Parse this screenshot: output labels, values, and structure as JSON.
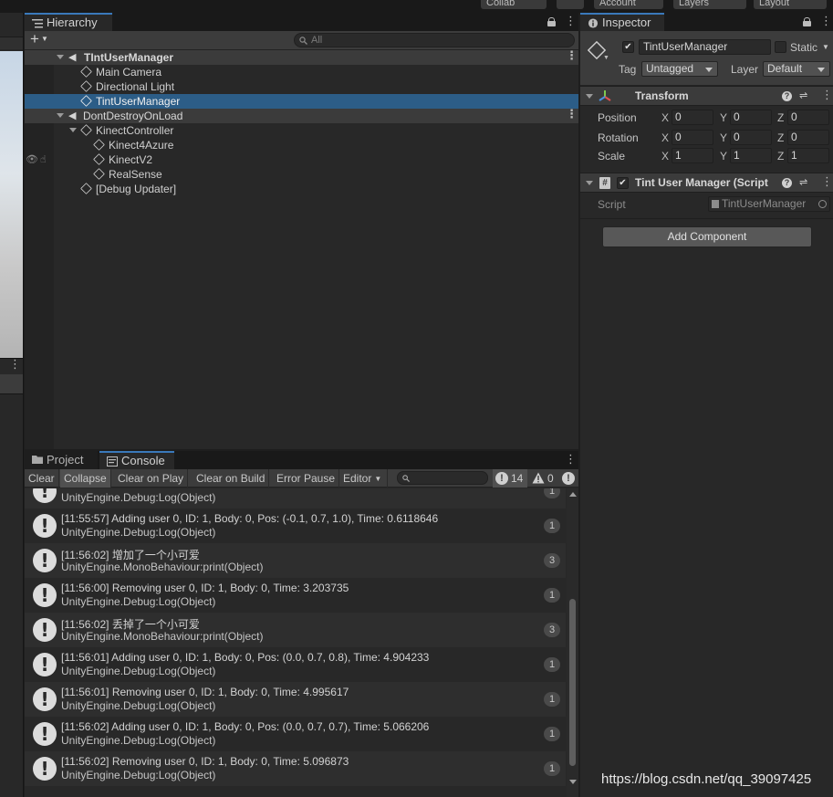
{
  "topbar": {
    "collab": "Collab",
    "account": "Account",
    "layers": "Layers",
    "layout": "Layout"
  },
  "hierarchy": {
    "tab_label": "Hierarchy",
    "search_placeholder": "All",
    "items": [
      {
        "label": "TIntUserManager",
        "kind": "scene"
      },
      {
        "label": "Main Camera",
        "kind": "object"
      },
      {
        "label": "Directional Light",
        "kind": "object"
      },
      {
        "label": "TintUserManager",
        "kind": "object",
        "selected": true
      },
      {
        "label": "DontDestroyOnLoad",
        "kind": "scene"
      },
      {
        "label": "KinectController",
        "kind": "object"
      },
      {
        "label": "Kinect4Azure",
        "kind": "object"
      },
      {
        "label": "KinectV2",
        "kind": "object"
      },
      {
        "label": "RealSense",
        "kind": "object"
      },
      {
        "label": "[Debug Updater]",
        "kind": "object"
      }
    ]
  },
  "console": {
    "tabs": [
      "Project",
      "Console"
    ],
    "toolbar": [
      "Clear",
      "Collapse",
      "Clear on Play",
      "Clear on Build",
      "Error Pause",
      "Editor"
    ],
    "counts": {
      "info": "14",
      "warnings": "0"
    },
    "entries": [
      {
        "line1": "",
        "line2": "UnityEngine.Debug:Log(Object)",
        "count": "1"
      },
      {
        "line1": "[11:55:57] Adding user 0, ID: 1, Body: 0, Pos: (-0.1, 0.7, 1.0), Time: 0.6118646",
        "line2": "UnityEngine.Debug:Log(Object)",
        "count": "1"
      },
      {
        "line1": "[11:56:02] 增加了一个小可爱",
        "line2": "UnityEngine.MonoBehaviour:print(Object)",
        "count": "3"
      },
      {
        "line1": "[11:56:00] Removing user 0, ID: 1, Body: 0, Time: 3.203735",
        "line2": "UnityEngine.Debug:Log(Object)",
        "count": "1"
      },
      {
        "line1": "[11:56:02] 丢掉了一个小可爱",
        "line2": "UnityEngine.MonoBehaviour:print(Object)",
        "count": "3"
      },
      {
        "line1": "[11:56:01] Adding user 0, ID: 1, Body: 0, Pos: (0.0, 0.7, 0.8), Time: 4.904233",
        "line2": "UnityEngine.Debug:Log(Object)",
        "count": "1"
      },
      {
        "line1": "[11:56:01] Removing user 0, ID: 1, Body: 0, Time: 4.995617",
        "line2": "UnityEngine.Debug:Log(Object)",
        "count": "1"
      },
      {
        "line1": "[11:56:02] Adding user 0, ID: 1, Body: 0, Pos: (0.0, 0.7, 0.7), Time: 5.066206",
        "line2": "UnityEngine.Debug:Log(Object)",
        "count": "1"
      },
      {
        "line1": "[11:56:02] Removing user 0, ID: 1, Body: 0, Time: 5.096873",
        "line2": "UnityEngine.Debug:Log(Object)",
        "count": "1"
      }
    ]
  },
  "inspector": {
    "tab_label": "Inspector",
    "object_name": "TintUserManager",
    "static_label": "Static",
    "tag_label": "Tag",
    "tag_value": "Untagged",
    "layer_label": "Layer",
    "layer_value": "Default",
    "transform": {
      "title": "Transform",
      "rows": [
        {
          "label": "Position",
          "x": "0",
          "y": "0",
          "z": "0"
        },
        {
          "label": "Rotation",
          "x": "0",
          "y": "0",
          "z": "0"
        },
        {
          "label": "Scale",
          "x": "1",
          "y": "1",
          "z": "1"
        }
      ],
      "axes": [
        "X",
        "Y",
        "Z"
      ]
    },
    "script_component": {
      "title": "Tint User Manager (Script",
      "field_label": "Script",
      "field_value": "TintUserManager"
    },
    "add_component": "Add Component"
  },
  "watermark": "https://blog.csdn.net/qq_39097425",
  "colors": {
    "selection": "#2c5d87",
    "tab_accent": "#3a79bb",
    "panel_bg": "#282828"
  }
}
